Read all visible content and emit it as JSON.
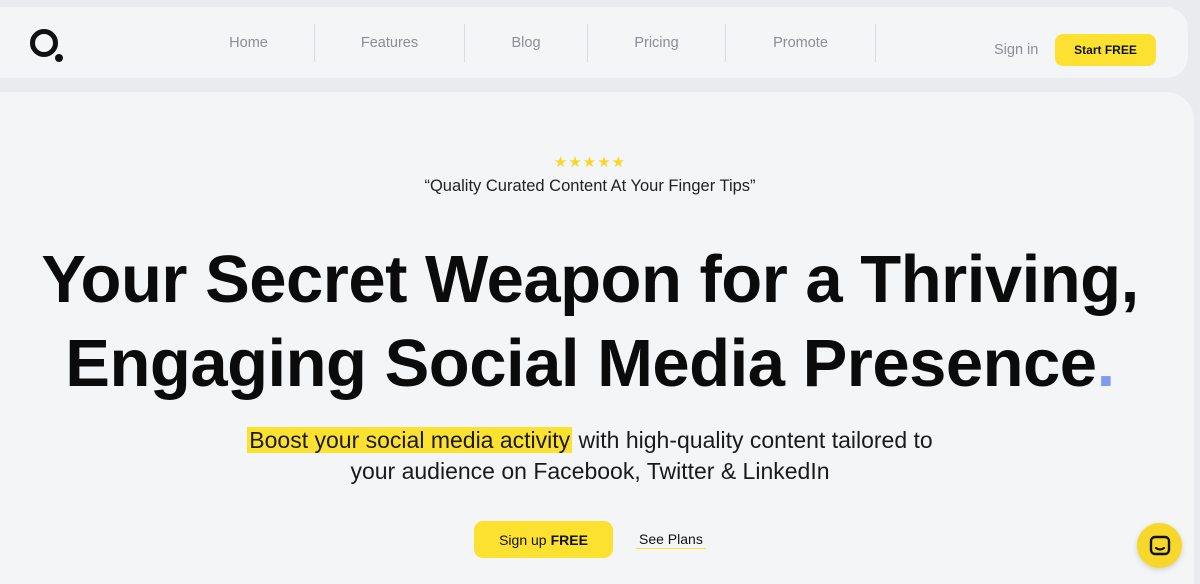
{
  "nav": {
    "links": [
      "Home",
      "Features",
      "Blog",
      "Pricing",
      "Promote"
    ],
    "sign_in": "Sign in",
    "start_free": "Start FREE"
  },
  "hero": {
    "stars": "★★★★★",
    "rating": 5,
    "tagline": "“Quality Curated Content At Your Finger Tips”",
    "headline_line1": "Your Secret Weapon for a Thriving,",
    "headline_line2": "Engaging Social Media Presence",
    "headline_dot": ".",
    "subtitle_highlight": "Boost your social media activity",
    "subtitle_rest1": " with high-quality content tailored to",
    "subtitle_rest2": "your audience on Facebook, Twitter & LinkedIn",
    "signup_prefix": "Sign up",
    "signup_bold": "FREE",
    "see_plans": "See Plans"
  },
  "colors": {
    "accent": "#fde130",
    "dot": "#7f9cf0",
    "nav_text": "#8a8f96"
  },
  "icons": {
    "logo": "logo-icon",
    "chat": "chat-icon"
  }
}
